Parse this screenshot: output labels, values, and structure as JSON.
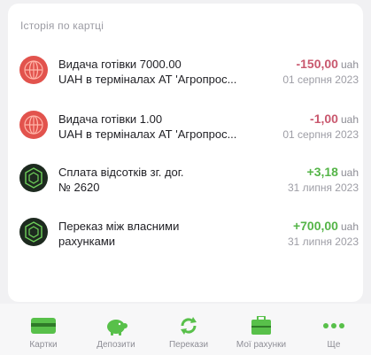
{
  "history": {
    "title": "Історія по картці",
    "transactions": [
      {
        "line1": "Видача готівки  7000.00",
        "line2": "UAH в терміналах АТ 'Агропрос...",
        "amount": "-150,00",
        "currency": "uah",
        "date": "01 серпня 2023"
      },
      {
        "line1": "Видача готівки  1.00",
        "line2": "UAH в терміналах АТ 'Агропрос...",
        "amount": "-1,00",
        "currency": "uah",
        "date": "01 серпня 2023"
      },
      {
        "line1": "Сплата відсотків зг. дог.",
        "line2": "№ 2620",
        "amount": "+3,18",
        "currency": "uah",
        "date": "31 липня 2023"
      },
      {
        "line1": "Переказ між власними",
        "line2": "рахунками",
        "amount": "+700,00",
        "currency": "uah",
        "date": "31 липня 2023"
      }
    ]
  },
  "tabbar": {
    "tabs": [
      {
        "label": "Картки",
        "icon": "card-icon"
      },
      {
        "label": "Депозити",
        "icon": "piggy-bank-icon"
      },
      {
        "label": "Перекази",
        "icon": "transfer-arrows-icon"
      },
      {
        "label": "Мої рахунки",
        "icon": "briefcase-icon"
      },
      {
        "label": "Ще",
        "icon": "more-dots-icon"
      }
    ]
  },
  "colors": {
    "negative": "#c9586e",
    "positive": "#55b548",
    "accent_green": "#58c04a",
    "atm_icon": "#e2534d",
    "interest_icon": "#1d2a1f"
  }
}
